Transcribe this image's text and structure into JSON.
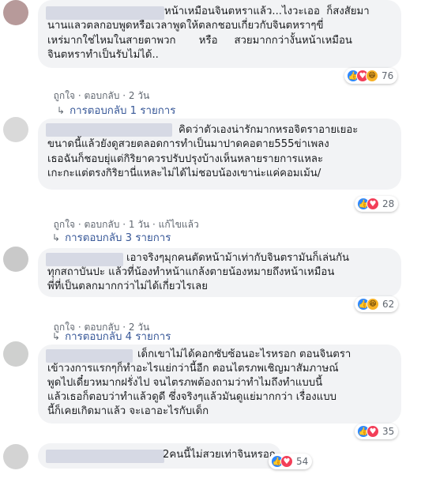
{
  "comments": [
    {
      "lines": [
        "หน้าเหมือนจินตหราแล้ว...ไงวะเออ  ก็สงสัยมา",
        "นานแลวตลกอบพูดหรือเวลาพูดให้ตลกชอบเกี่ยวกับจินตหราๆขี่",
        "เหร่มากใช่ไหมในสายตาพวก       หรือ     สวยมากกว่างั้นหน้าเหมือน",
        "จินตหราทำเป็นรับไม่ได้.."
      ],
      "meta": [
        "ถูกใจ",
        "ตอบกลับ",
        "2 วัน"
      ],
      "count": "76",
      "reactions": [
        "like",
        "love",
        "haha"
      ],
      "reply_link": "การตอบกลับ 1 รายการ"
    },
    {
      "lines": [
        "คิดว่าตัวเองน่ารักมากหรอจิตราอายเยอะ",
        "ขนาดนี้แล้วยังดูสวยตลอดการทำเป็นมาปาดคอตาย555ข่าเพลง",
        "เธอฉันก็ชอบยุ่แต่กิริยาควรปรับปรุงบ้างเห็นหลายรายการแหละ",
        "เกะกะแต่ตรงกิริยานี่แหละไม่ได้ไม่ชอบน้องเขาน่ะแค่คอมเม้น/"
      ],
      "meta": [
        "ถูกใจ",
        "ตอบกลับ",
        "1 วัน",
        "แก้ไขแล้ว"
      ],
      "count": "28",
      "reactions": [
        "like",
        "love"
      ],
      "reply_link": "การตอบกลับ 3 รายการ"
    },
    {
      "lines": [
        "เอาจริงๆมุกคนตัดหน้าม้าเท่ากับจินตรามันก็เล่นกัน",
        "ทุกสถาบันปะ แล้วที่น้องทำหน้าแกล้งตายน้องหมายถึงหน้าเหมือน",
        "พี่ที่เป็นตลกมากกว่าไม่ได้เกี่ยวไรเลย"
      ],
      "meta": [
        "ถูกใจ",
        "ตอบกลับ",
        "2 วัน"
      ],
      "count": "62",
      "reactions": [
        "like",
        "haha"
      ],
      "reply_link": "การตอบกลับ 4 รายการ"
    },
    {
      "lines": [
        "เด็กเขาไม่ได้คอกซับซ้อนอะไรหรอก ตอนจินตรา",
        "เข้าวงการแรกๆก็ทำอะไรแย่กว่านี้อีก ตอนไตรภพเชิญมาสัมภาษณ์",
        "พูดไปเดี๋ยวหมากฝรั่งไป จนไตรภพต้องถามว่าทำไมถึงทำแบบนี้",
        "แล้วเธอก็ตอบว่าทำแล้วดูดี ซึ่งจริงๆแล้วมันดูแย่มากกว่า เรื่องแบบ",
        "นี้ก็เคยเกิดมาแล้ว จะเอาอะไรกับเด็ก"
      ],
      "count": "35",
      "reactions": [
        "like",
        "love"
      ]
    },
    {
      "lines": [
        "2คนนี้ไม่สวยเท่าจินหรอก"
      ],
      "count": "54",
      "reactions": [
        "like",
        "love"
      ]
    }
  ],
  "colors": {
    "bubble": "#f2f3f5",
    "link": "#385898",
    "meta": "#606770",
    "like": "#2d88ff",
    "love": "#f33e58",
    "haha": "#f7b125"
  },
  "icons": {
    "like": "thumbs-up-icon",
    "love": "heart-icon",
    "haha": "laughing-face-icon",
    "reply": "reply-arrow-icon"
  }
}
